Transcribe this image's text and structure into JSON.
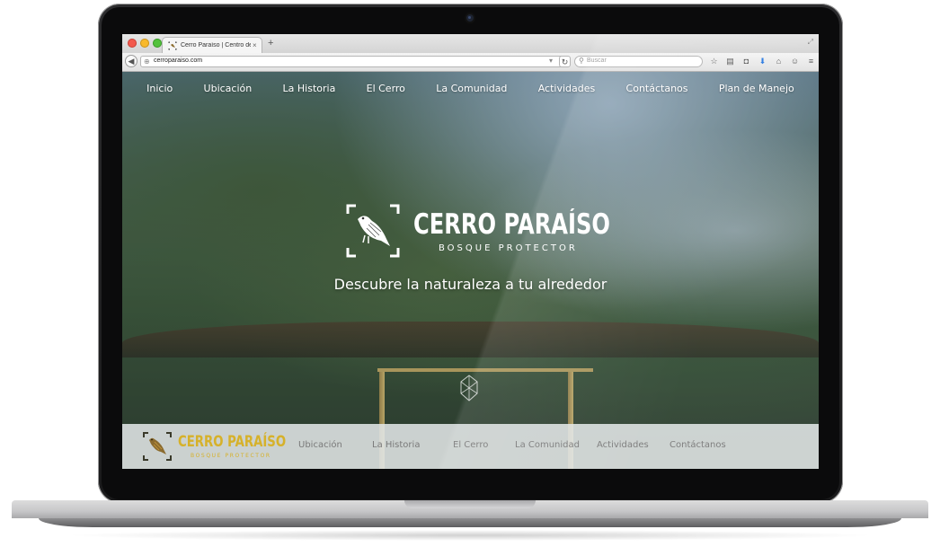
{
  "browser": {
    "tab_title": "Cerro Paraíso | Centro de ...",
    "tab_close": "×",
    "new_tab": "+",
    "url": "cerroparaiso.com",
    "search_placeholder": "Buscar"
  },
  "main_nav": {
    "items": [
      "Inicio",
      "Ubicación",
      "La Historia",
      "El Cerro",
      "La Comunidad",
      "Actividades",
      "Contáctanos",
      "Plan de Manejo"
    ]
  },
  "hero": {
    "brand_title": "CERRO PARAÍSO",
    "brand_subtitle": "BOSQUE PROTECTOR",
    "tagline": "Descubre la naturaleza a tu alrededor"
  },
  "footer": {
    "brand_title": "CERRO PARAÍSO",
    "brand_subtitle": "BOSQUE PROTECTOR",
    "nav_items": [
      "Ubicación",
      "La Historia",
      "El Cerro",
      "La Comunidad",
      "Actividades",
      "Contáctanos"
    ]
  },
  "colors": {
    "footer_accent": "#d6b12a",
    "nav_text": "#ffffff",
    "footer_nav_text": "#7a7a7a"
  }
}
